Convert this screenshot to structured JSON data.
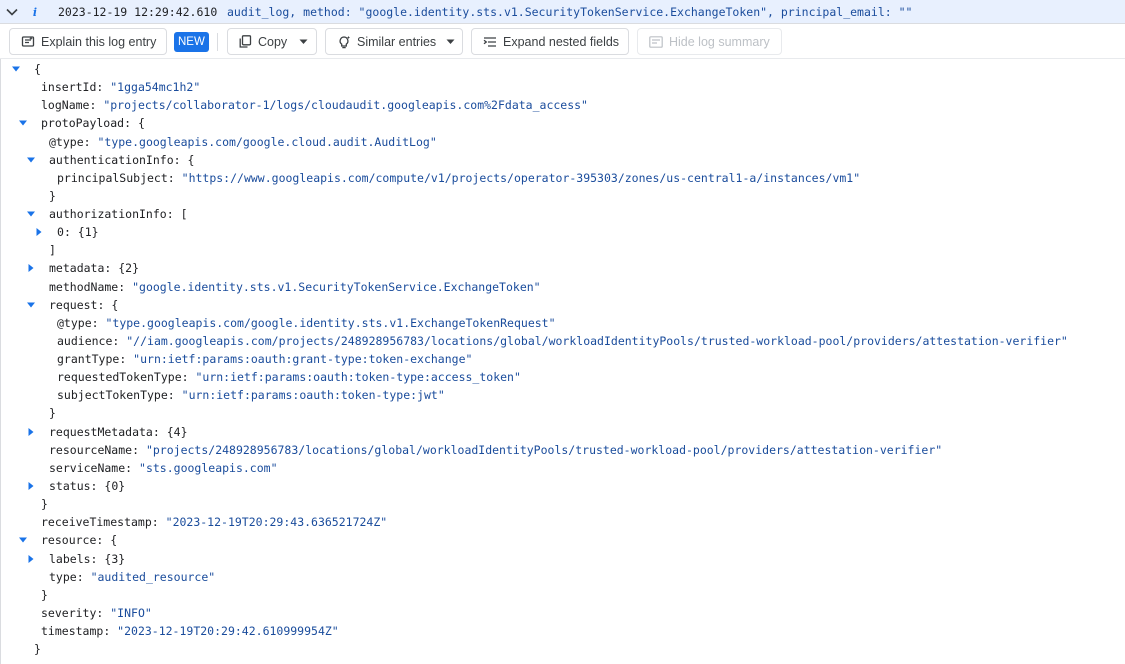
{
  "summary": {
    "severity_icon": "info-icon",
    "timestamp": "2023-12-19 12:29:42.610",
    "text": "audit_log, method: \"google.identity.sts.v1.SecurityTokenService.ExchangeToken\", principal_email: \"\""
  },
  "toolbar": {
    "explain_label": "Explain this log entry",
    "new_badge": "NEW",
    "copy_label": "Copy",
    "similar_label": "Similar entries",
    "expand_label": "Expand nested fields",
    "hide_label": "Hide log summary"
  },
  "colors": {
    "accent": "#1a73e8",
    "string": "#1a4c9c",
    "summary_bg": "#e8f0fe"
  },
  "tree": [
    {
      "indent": 0,
      "toggle": "down",
      "key": "",
      "value": "{",
      "type": "punct"
    },
    {
      "indent": 1,
      "toggle": "",
      "key": "insertId",
      "value": "\"1gga54mc1h2\"",
      "type": "string"
    },
    {
      "indent": 1,
      "toggle": "",
      "key": "logName",
      "value": "\"projects/collaborator-1/logs/cloudaudit.googleapis.com%2Fdata_access\"",
      "type": "string"
    },
    {
      "indent": 1,
      "toggle": "down",
      "key": "protoPayload",
      "value": "{",
      "type": "punct"
    },
    {
      "indent": 2,
      "toggle": "",
      "key": "@type",
      "value": "\"type.googleapis.com/google.cloud.audit.AuditLog\"",
      "type": "string"
    },
    {
      "indent": 2,
      "toggle": "down",
      "key": "authenticationInfo",
      "value": "{",
      "type": "punct"
    },
    {
      "indent": 3,
      "toggle": "",
      "key": "principalSubject",
      "value": "\"https://www.googleapis.com/compute/v1/projects/operator-395303/zones/us-central1-a/instances/vm1\"",
      "type": "string"
    },
    {
      "indent": 2,
      "toggle": "",
      "key": "",
      "value": "}",
      "type": "punct"
    },
    {
      "indent": 2,
      "toggle": "down",
      "key": "authorizationInfo",
      "value": "[",
      "type": "punct"
    },
    {
      "indent": 3,
      "toggle": "right",
      "key": "0",
      "value": "{1}",
      "type": "punct"
    },
    {
      "indent": 2,
      "toggle": "",
      "key": "",
      "value": "]",
      "type": "punct"
    },
    {
      "indent": 2,
      "toggle": "right",
      "key": "metadata",
      "value": "{2}",
      "type": "punct"
    },
    {
      "indent": 2,
      "toggle": "",
      "key": "methodName",
      "value": "\"google.identity.sts.v1.SecurityTokenService.ExchangeToken\"",
      "type": "string"
    },
    {
      "indent": 2,
      "toggle": "down",
      "key": "request",
      "value": "{",
      "type": "punct"
    },
    {
      "indent": 3,
      "toggle": "",
      "key": "@type",
      "value": "\"type.googleapis.com/google.identity.sts.v1.ExchangeTokenRequest\"",
      "type": "string"
    },
    {
      "indent": 3,
      "toggle": "",
      "key": "audience",
      "value": "\"//iam.googleapis.com/projects/248928956783/locations/global/workloadIdentityPools/trusted-workload-pool/providers/attestation-verifier\"",
      "type": "string"
    },
    {
      "indent": 3,
      "toggle": "",
      "key": "grantType",
      "value": "\"urn:ietf:params:oauth:grant-type:token-exchange\"",
      "type": "string"
    },
    {
      "indent": 3,
      "toggle": "",
      "key": "requestedTokenType",
      "value": "\"urn:ietf:params:oauth:token-type:access_token\"",
      "type": "string"
    },
    {
      "indent": 3,
      "toggle": "",
      "key": "subjectTokenType",
      "value": "\"urn:ietf:params:oauth:token-type:jwt\"",
      "type": "string"
    },
    {
      "indent": 2,
      "toggle": "",
      "key": "",
      "value": "}",
      "type": "punct"
    },
    {
      "indent": 2,
      "toggle": "right",
      "key": "requestMetadata",
      "value": "{4}",
      "type": "punct"
    },
    {
      "indent": 2,
      "toggle": "",
      "key": "resourceName",
      "value": "\"projects/248928956783/locations/global/workloadIdentityPools/trusted-workload-pool/providers/attestation-verifier\"",
      "type": "string"
    },
    {
      "indent": 2,
      "toggle": "",
      "key": "serviceName",
      "value": "\"sts.googleapis.com\"",
      "type": "string"
    },
    {
      "indent": 2,
      "toggle": "right",
      "key": "status",
      "value": "{0}",
      "type": "punct"
    },
    {
      "indent": 1,
      "toggle": "",
      "key": "",
      "value": "}",
      "type": "punct"
    },
    {
      "indent": 1,
      "toggle": "",
      "key": "receiveTimestamp",
      "value": "\"2023-12-19T20:29:43.636521724Z\"",
      "type": "string"
    },
    {
      "indent": 1,
      "toggle": "down",
      "key": "resource",
      "value": "{",
      "type": "punct"
    },
    {
      "indent": 2,
      "toggle": "right",
      "key": "labels",
      "value": "{3}",
      "type": "punct"
    },
    {
      "indent": 2,
      "toggle": "",
      "key": "type",
      "value": "\"audited_resource\"",
      "type": "string"
    },
    {
      "indent": 1,
      "toggle": "",
      "key": "",
      "value": "}",
      "type": "punct"
    },
    {
      "indent": 1,
      "toggle": "",
      "key": "severity",
      "value": "\"INFO\"",
      "type": "string"
    },
    {
      "indent": 1,
      "toggle": "",
      "key": "timestamp",
      "value": "\"2023-12-19T20:29:42.610999954Z\"",
      "type": "string"
    },
    {
      "indent": 0,
      "toggle": "",
      "key": "",
      "value": "}",
      "type": "punct"
    }
  ]
}
